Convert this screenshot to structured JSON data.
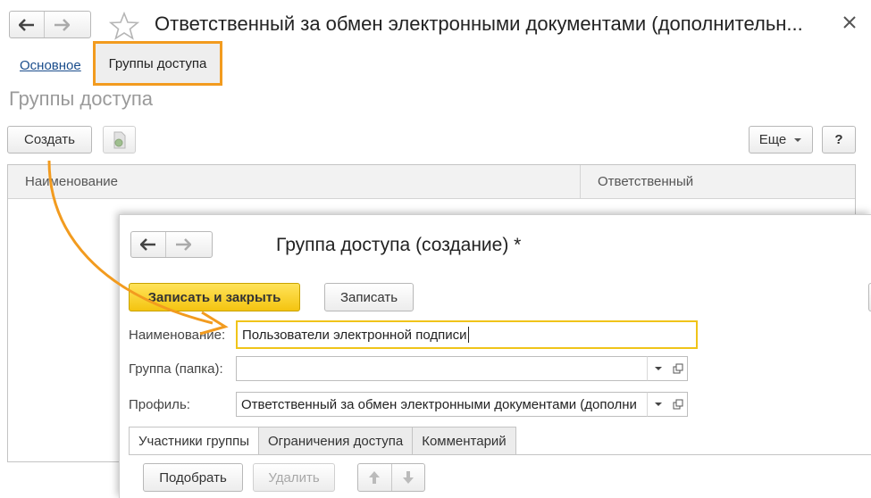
{
  "window": {
    "title": "Ответственный за обмен электронными документами (дополнительн...",
    "tabs": [
      {
        "label": "Основное"
      },
      {
        "label": "Группы доступа"
      }
    ],
    "section_title": "Группы доступа",
    "toolbar": {
      "create_label": "Создать",
      "more_label": "Еще",
      "help_label": "?"
    },
    "grid": {
      "columns": [
        "Наименование",
        "Ответственный"
      ]
    }
  },
  "subwindow": {
    "title": "Группа доступа (создание) *",
    "save_close_label": "Записать и закрыть",
    "save_label": "Записать",
    "fields": {
      "name_label": "Наименование:",
      "name_value": "Пользователи электронной подписи",
      "group_label": "Группа (папка):",
      "group_value": "",
      "profile_label": "Профиль:",
      "profile_value": "Ответственный за обмен электронными документами (дополни"
    },
    "tabs": [
      {
        "label": "Участники группы"
      },
      {
        "label": "Ограничения доступа"
      },
      {
        "label": "Комментарий"
      }
    ],
    "members_toolbar": {
      "pick_label": "Подобрать",
      "delete_label": "Удалить"
    }
  },
  "colors": {
    "highlight": "#f29b1f",
    "primary_button": "#f4c410",
    "link": "#1a4d8c"
  }
}
